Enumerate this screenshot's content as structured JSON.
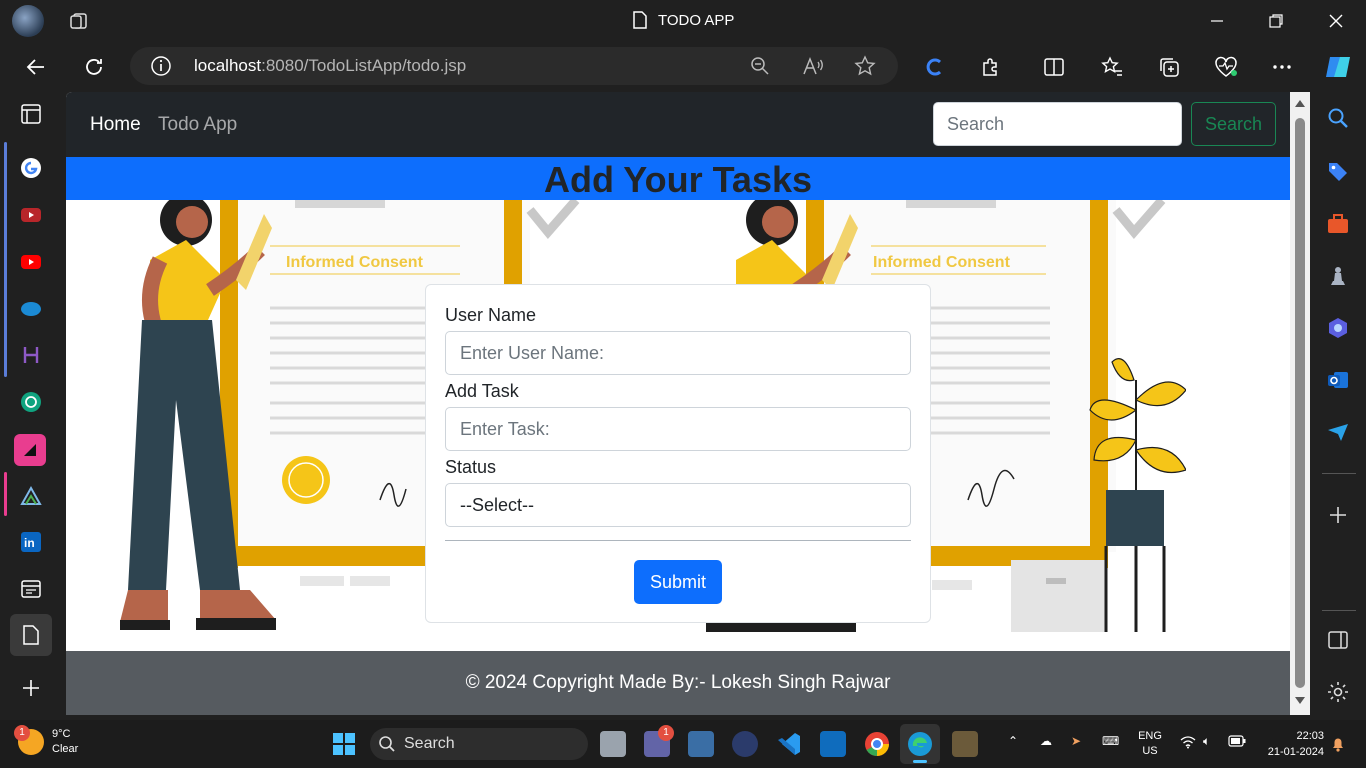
{
  "browser": {
    "window_title": "TODO APP",
    "url_host": "localhost",
    "url_rest": ":8080/TodoListApp/todo.jsp"
  },
  "navbar": {
    "home": "Home",
    "brand": "Todo App",
    "search_placeholder": "Search",
    "search_button": "Search"
  },
  "banner": {
    "title": "Add Your Tasks"
  },
  "illustration": {
    "caption": "Informed Consent"
  },
  "form": {
    "username_label": "User Name",
    "username_placeholder": "Enter User Name:",
    "task_label": "Add Task",
    "task_placeholder": "Enter Task:",
    "status_label": "Status",
    "status_selected": "--Select--",
    "submit": "Submit"
  },
  "footer": {
    "text": "© 2024 Copyright Made By:- Lokesh Singh Rajwar"
  },
  "taskbar": {
    "weather_temp": "9°C",
    "weather_desc": "Clear",
    "weather_badge": "1",
    "search": "Search",
    "teams_badge": "1",
    "lang": "ENG",
    "region": "US",
    "time": "22:03",
    "date": "21-01-2024"
  },
  "colors": {
    "primary": "#0d6efd",
    "navbar": "#212529",
    "success": "#198754",
    "footer": "#565b60",
    "illustration_accent": "#f5c518"
  }
}
